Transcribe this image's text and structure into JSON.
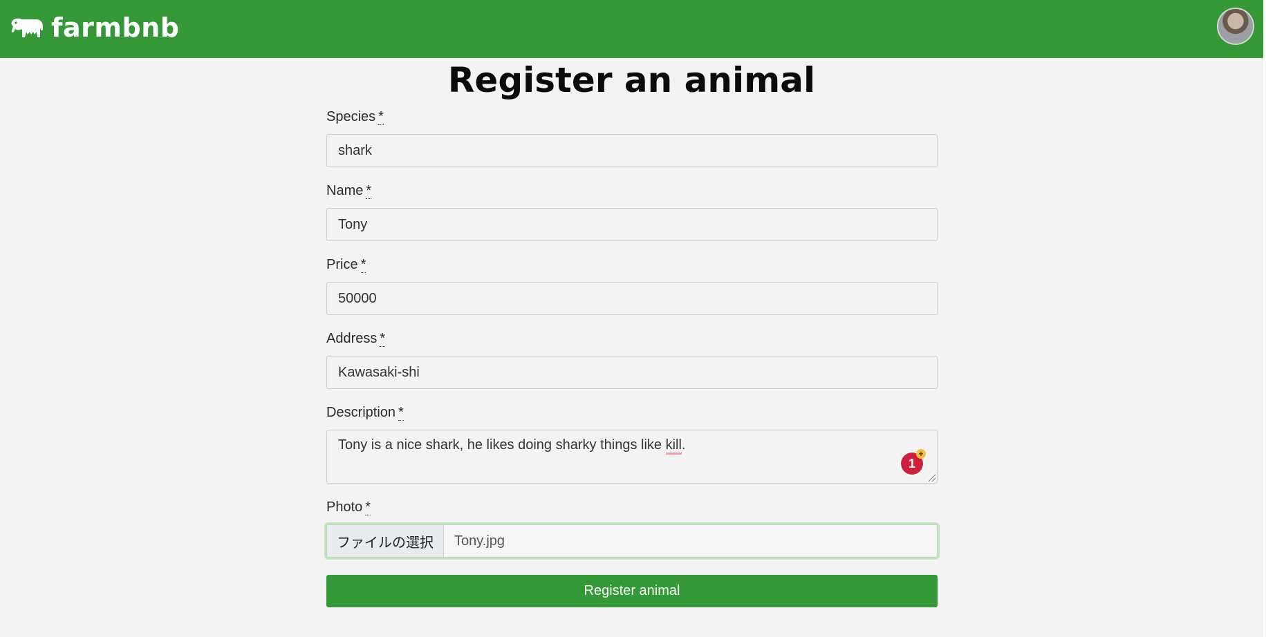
{
  "navbar": {
    "brand_name": "farmbnb",
    "logo_icon": "cow-icon",
    "avatar_icon": "user-avatar-icon",
    "background_color": "#339835"
  },
  "page": {
    "title": "Register an animal"
  },
  "form": {
    "required_marker": "*",
    "fields": {
      "species": {
        "label": "Species",
        "value": "shark"
      },
      "name": {
        "label": "Name",
        "value": "Tony"
      },
      "price": {
        "label": "Price",
        "value": "50000"
      },
      "address": {
        "label": "Address",
        "value": "Kawasaki-shi"
      },
      "description": {
        "label": "Description",
        "value_before": "Tony is a nice shark, he likes doing sharky things like ",
        "value_misspelled": "kill",
        "value_after": ".",
        "grammar_badge_count": "1",
        "grammar_badge_plus": "+"
      },
      "photo": {
        "label": "Photo",
        "choose_button": "ファイルの選択",
        "file_name": "Tony.jpg"
      }
    },
    "submit_label": "Register animal",
    "submit_color": "#339835"
  }
}
